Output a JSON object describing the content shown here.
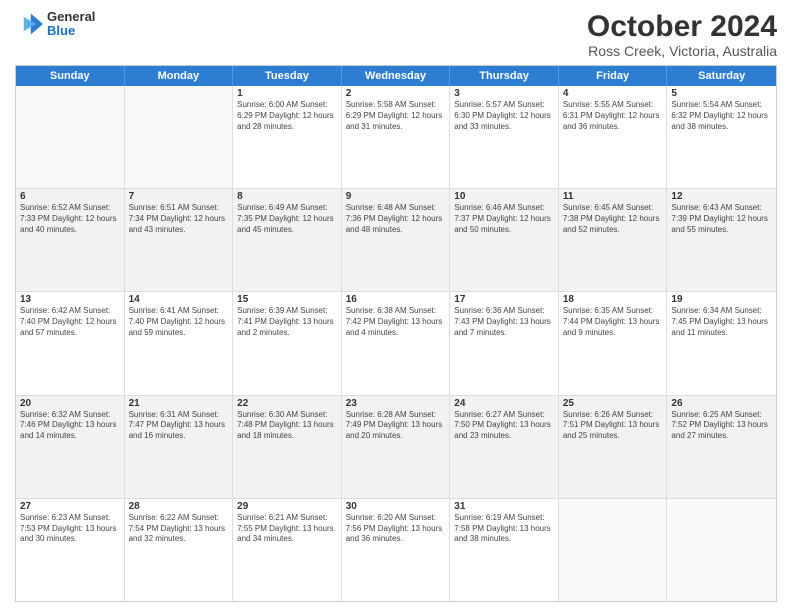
{
  "logo": {
    "general": "General",
    "blue": "Blue"
  },
  "title": {
    "month": "October 2024",
    "location": "Ross Creek, Victoria, Australia"
  },
  "header_days": [
    "Sunday",
    "Monday",
    "Tuesday",
    "Wednesday",
    "Thursday",
    "Friday",
    "Saturday"
  ],
  "weeks": [
    [
      {
        "day": "",
        "info": ""
      },
      {
        "day": "",
        "info": ""
      },
      {
        "day": "1",
        "info": "Sunrise: 6:00 AM\nSunset: 6:29 PM\nDaylight: 12 hours and 28 minutes."
      },
      {
        "day": "2",
        "info": "Sunrise: 5:58 AM\nSunset: 6:29 PM\nDaylight: 12 hours and 31 minutes."
      },
      {
        "day": "3",
        "info": "Sunrise: 5:57 AM\nSunset: 6:30 PM\nDaylight: 12 hours and 33 minutes."
      },
      {
        "day": "4",
        "info": "Sunrise: 5:55 AM\nSunset: 6:31 PM\nDaylight: 12 hours and 36 minutes."
      },
      {
        "day": "5",
        "info": "Sunrise: 5:54 AM\nSunset: 6:32 PM\nDaylight: 12 hours and 38 minutes."
      }
    ],
    [
      {
        "day": "6",
        "info": "Sunrise: 6:52 AM\nSunset: 7:33 PM\nDaylight: 12 hours and 40 minutes."
      },
      {
        "day": "7",
        "info": "Sunrise: 6:51 AM\nSunset: 7:34 PM\nDaylight: 12 hours and 43 minutes."
      },
      {
        "day": "8",
        "info": "Sunrise: 6:49 AM\nSunset: 7:35 PM\nDaylight: 12 hours and 45 minutes."
      },
      {
        "day": "9",
        "info": "Sunrise: 6:48 AM\nSunset: 7:36 PM\nDaylight: 12 hours and 48 minutes."
      },
      {
        "day": "10",
        "info": "Sunrise: 6:46 AM\nSunset: 7:37 PM\nDaylight: 12 hours and 50 minutes."
      },
      {
        "day": "11",
        "info": "Sunrise: 6:45 AM\nSunset: 7:38 PM\nDaylight: 12 hours and 52 minutes."
      },
      {
        "day": "12",
        "info": "Sunrise: 6:43 AM\nSunset: 7:39 PM\nDaylight: 12 hours and 55 minutes."
      }
    ],
    [
      {
        "day": "13",
        "info": "Sunrise: 6:42 AM\nSunset: 7:40 PM\nDaylight: 12 hours and 57 minutes."
      },
      {
        "day": "14",
        "info": "Sunrise: 6:41 AM\nSunset: 7:40 PM\nDaylight: 12 hours and 59 minutes."
      },
      {
        "day": "15",
        "info": "Sunrise: 6:39 AM\nSunset: 7:41 PM\nDaylight: 13 hours and 2 minutes."
      },
      {
        "day": "16",
        "info": "Sunrise: 6:38 AM\nSunset: 7:42 PM\nDaylight: 13 hours and 4 minutes."
      },
      {
        "day": "17",
        "info": "Sunrise: 6:36 AM\nSunset: 7:43 PM\nDaylight: 13 hours and 7 minutes."
      },
      {
        "day": "18",
        "info": "Sunrise: 6:35 AM\nSunset: 7:44 PM\nDaylight: 13 hours and 9 minutes."
      },
      {
        "day": "19",
        "info": "Sunrise: 6:34 AM\nSunset: 7:45 PM\nDaylight: 13 hours and 11 minutes."
      }
    ],
    [
      {
        "day": "20",
        "info": "Sunrise: 6:32 AM\nSunset: 7:46 PM\nDaylight: 13 hours and 14 minutes."
      },
      {
        "day": "21",
        "info": "Sunrise: 6:31 AM\nSunset: 7:47 PM\nDaylight: 13 hours and 16 minutes."
      },
      {
        "day": "22",
        "info": "Sunrise: 6:30 AM\nSunset: 7:48 PM\nDaylight: 13 hours and 18 minutes."
      },
      {
        "day": "23",
        "info": "Sunrise: 6:28 AM\nSunset: 7:49 PM\nDaylight: 13 hours and 20 minutes."
      },
      {
        "day": "24",
        "info": "Sunrise: 6:27 AM\nSunset: 7:50 PM\nDaylight: 13 hours and 23 minutes."
      },
      {
        "day": "25",
        "info": "Sunrise: 6:26 AM\nSunset: 7:51 PM\nDaylight: 13 hours and 25 minutes."
      },
      {
        "day": "26",
        "info": "Sunrise: 6:25 AM\nSunset: 7:52 PM\nDaylight: 13 hours and 27 minutes."
      }
    ],
    [
      {
        "day": "27",
        "info": "Sunrise: 6:23 AM\nSunset: 7:53 PM\nDaylight: 13 hours and 30 minutes."
      },
      {
        "day": "28",
        "info": "Sunrise: 6:22 AM\nSunset: 7:54 PM\nDaylight: 13 hours and 32 minutes."
      },
      {
        "day": "29",
        "info": "Sunrise: 6:21 AM\nSunset: 7:55 PM\nDaylight: 13 hours and 34 minutes."
      },
      {
        "day": "30",
        "info": "Sunrise: 6:20 AM\nSunset: 7:56 PM\nDaylight: 13 hours and 36 minutes."
      },
      {
        "day": "31",
        "info": "Sunrise: 6:19 AM\nSunset: 7:58 PM\nDaylight: 13 hours and 38 minutes."
      },
      {
        "day": "",
        "info": ""
      },
      {
        "day": "",
        "info": ""
      }
    ]
  ]
}
